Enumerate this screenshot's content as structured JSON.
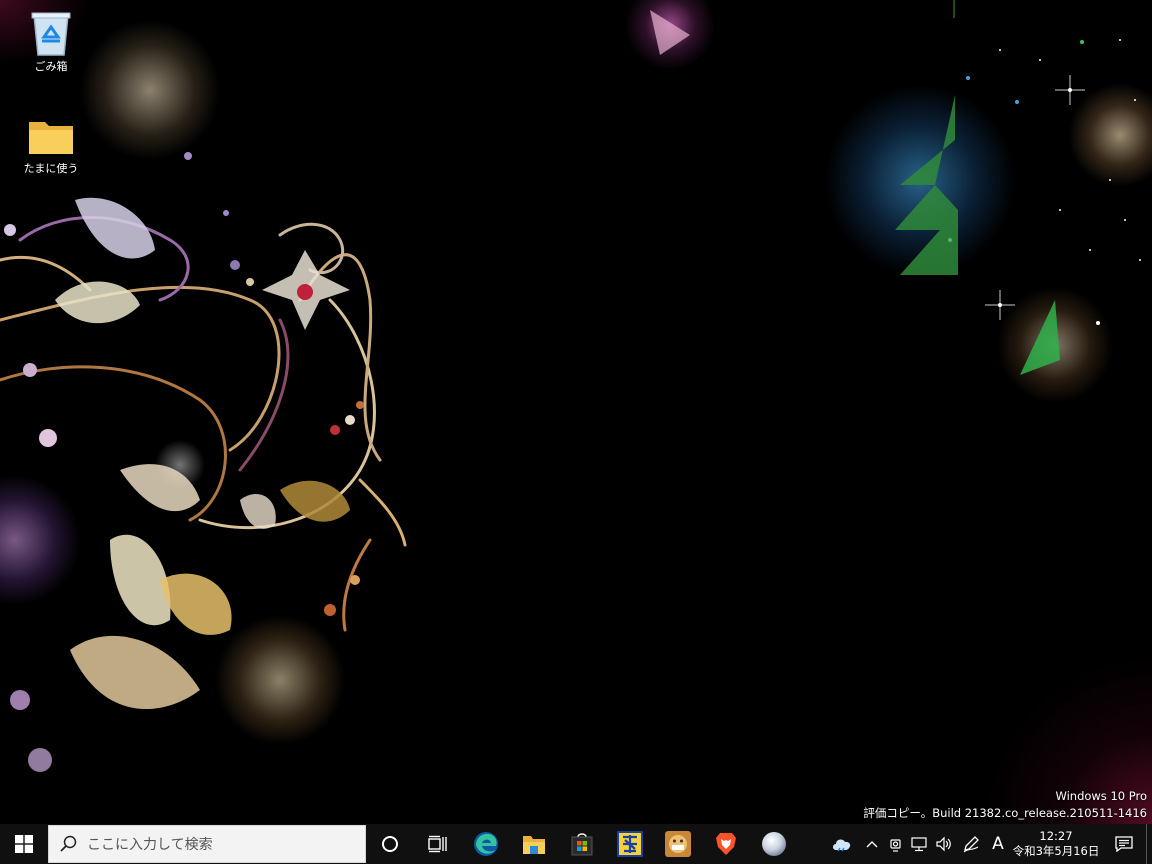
{
  "desktop": {
    "icons": [
      {
        "label": "ごみ箱",
        "icon": "recycle-bin-icon"
      },
      {
        "label": "たまに使う",
        "icon": "folder-icon"
      }
    ],
    "watermark": {
      "line1": "Windows 10 Pro",
      "line2": "評価コピー。Build 21382.co_release.210511-1416"
    }
  },
  "taskbar": {
    "search_placeholder": "ここに入力して検索",
    "pinned_apps": [
      {
        "name": "cortana-button",
        "icon": "circle-icon"
      },
      {
        "name": "task-view-button",
        "icon": "task-view-icon"
      },
      {
        "name": "edge-button",
        "icon": "edge-icon"
      },
      {
        "name": "file-explorer-button",
        "icon": "folder-icon"
      },
      {
        "name": "store-button",
        "icon": "store-icon"
      },
      {
        "name": "app-kanji-button",
        "icon": "kanji-app-icon"
      },
      {
        "name": "app-character-button",
        "icon": "character-app-icon"
      },
      {
        "name": "brave-button",
        "icon": "brave-lion-icon"
      },
      {
        "name": "app-sphere-button",
        "icon": "sphere-icon"
      }
    ],
    "tray": {
      "ime_mode": "A",
      "time": "12:27",
      "date": "令和3年5月16日"
    }
  },
  "colors": {
    "taskbar_bg": "#101010",
    "search_bg": "#f3f3f3",
    "windows_blue": "#00a2ed"
  }
}
